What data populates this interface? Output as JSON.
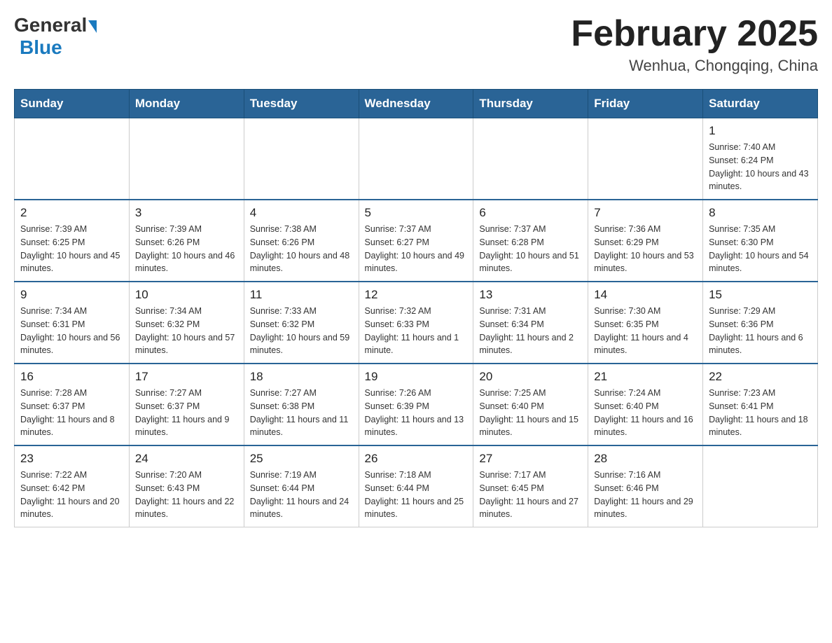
{
  "header": {
    "logo_general": "General",
    "logo_blue": "Blue",
    "month_title": "February 2025",
    "location": "Wenhua, Chongqing, China"
  },
  "days_of_week": [
    "Sunday",
    "Monday",
    "Tuesday",
    "Wednesday",
    "Thursday",
    "Friday",
    "Saturday"
  ],
  "weeks": [
    [
      {
        "day": "",
        "info": ""
      },
      {
        "day": "",
        "info": ""
      },
      {
        "day": "",
        "info": ""
      },
      {
        "day": "",
        "info": ""
      },
      {
        "day": "",
        "info": ""
      },
      {
        "day": "",
        "info": ""
      },
      {
        "day": "1",
        "info": "Sunrise: 7:40 AM\nSunset: 6:24 PM\nDaylight: 10 hours and 43 minutes."
      }
    ],
    [
      {
        "day": "2",
        "info": "Sunrise: 7:39 AM\nSunset: 6:25 PM\nDaylight: 10 hours and 45 minutes."
      },
      {
        "day": "3",
        "info": "Sunrise: 7:39 AM\nSunset: 6:26 PM\nDaylight: 10 hours and 46 minutes."
      },
      {
        "day": "4",
        "info": "Sunrise: 7:38 AM\nSunset: 6:26 PM\nDaylight: 10 hours and 48 minutes."
      },
      {
        "day": "5",
        "info": "Sunrise: 7:37 AM\nSunset: 6:27 PM\nDaylight: 10 hours and 49 minutes."
      },
      {
        "day": "6",
        "info": "Sunrise: 7:37 AM\nSunset: 6:28 PM\nDaylight: 10 hours and 51 minutes."
      },
      {
        "day": "7",
        "info": "Sunrise: 7:36 AM\nSunset: 6:29 PM\nDaylight: 10 hours and 53 minutes."
      },
      {
        "day": "8",
        "info": "Sunrise: 7:35 AM\nSunset: 6:30 PM\nDaylight: 10 hours and 54 minutes."
      }
    ],
    [
      {
        "day": "9",
        "info": "Sunrise: 7:34 AM\nSunset: 6:31 PM\nDaylight: 10 hours and 56 minutes."
      },
      {
        "day": "10",
        "info": "Sunrise: 7:34 AM\nSunset: 6:32 PM\nDaylight: 10 hours and 57 minutes."
      },
      {
        "day": "11",
        "info": "Sunrise: 7:33 AM\nSunset: 6:32 PM\nDaylight: 10 hours and 59 minutes."
      },
      {
        "day": "12",
        "info": "Sunrise: 7:32 AM\nSunset: 6:33 PM\nDaylight: 11 hours and 1 minute."
      },
      {
        "day": "13",
        "info": "Sunrise: 7:31 AM\nSunset: 6:34 PM\nDaylight: 11 hours and 2 minutes."
      },
      {
        "day": "14",
        "info": "Sunrise: 7:30 AM\nSunset: 6:35 PM\nDaylight: 11 hours and 4 minutes."
      },
      {
        "day": "15",
        "info": "Sunrise: 7:29 AM\nSunset: 6:36 PM\nDaylight: 11 hours and 6 minutes."
      }
    ],
    [
      {
        "day": "16",
        "info": "Sunrise: 7:28 AM\nSunset: 6:37 PM\nDaylight: 11 hours and 8 minutes."
      },
      {
        "day": "17",
        "info": "Sunrise: 7:27 AM\nSunset: 6:37 PM\nDaylight: 11 hours and 9 minutes."
      },
      {
        "day": "18",
        "info": "Sunrise: 7:27 AM\nSunset: 6:38 PM\nDaylight: 11 hours and 11 minutes."
      },
      {
        "day": "19",
        "info": "Sunrise: 7:26 AM\nSunset: 6:39 PM\nDaylight: 11 hours and 13 minutes."
      },
      {
        "day": "20",
        "info": "Sunrise: 7:25 AM\nSunset: 6:40 PM\nDaylight: 11 hours and 15 minutes."
      },
      {
        "day": "21",
        "info": "Sunrise: 7:24 AM\nSunset: 6:40 PM\nDaylight: 11 hours and 16 minutes."
      },
      {
        "day": "22",
        "info": "Sunrise: 7:23 AM\nSunset: 6:41 PM\nDaylight: 11 hours and 18 minutes."
      }
    ],
    [
      {
        "day": "23",
        "info": "Sunrise: 7:22 AM\nSunset: 6:42 PM\nDaylight: 11 hours and 20 minutes."
      },
      {
        "day": "24",
        "info": "Sunrise: 7:20 AM\nSunset: 6:43 PM\nDaylight: 11 hours and 22 minutes."
      },
      {
        "day": "25",
        "info": "Sunrise: 7:19 AM\nSunset: 6:44 PM\nDaylight: 11 hours and 24 minutes."
      },
      {
        "day": "26",
        "info": "Sunrise: 7:18 AM\nSunset: 6:44 PM\nDaylight: 11 hours and 25 minutes."
      },
      {
        "day": "27",
        "info": "Sunrise: 7:17 AM\nSunset: 6:45 PM\nDaylight: 11 hours and 27 minutes."
      },
      {
        "day": "28",
        "info": "Sunrise: 7:16 AM\nSunset: 6:46 PM\nDaylight: 11 hours and 29 minutes."
      },
      {
        "day": "",
        "info": ""
      }
    ]
  ]
}
